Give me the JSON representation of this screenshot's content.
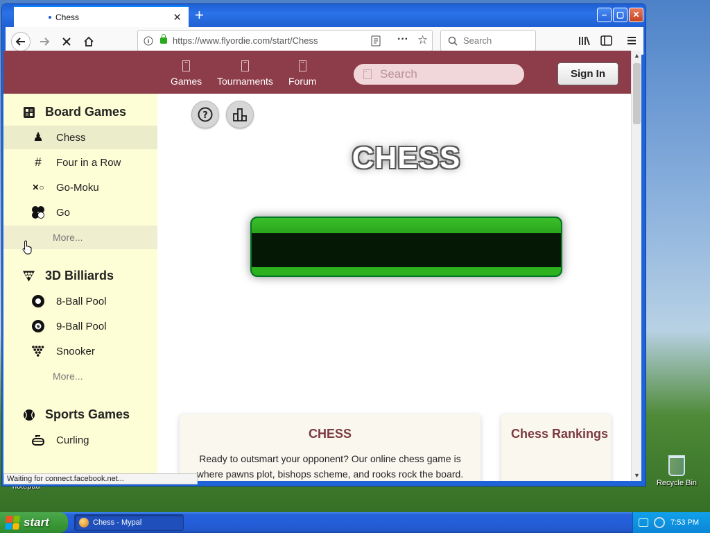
{
  "desktop": {
    "recycle_bin_label": "Recycle Bin",
    "partial_icon_label": "notepad"
  },
  "taskbar": {
    "start_label": "start",
    "task_item_label": "Chess - Mypal",
    "clock": "7:53 PM"
  },
  "browser": {
    "tab_title": "Chess",
    "url": "https://www.flyordie.com/start/Chess",
    "search_placeholder": "Search",
    "status_text": "Waiting for connect.facebook.net..."
  },
  "site": {
    "nav": [
      {
        "label": "Games"
      },
      {
        "label": "Tournaments"
      },
      {
        "label": "Forum"
      }
    ],
    "search_placeholder": "Search",
    "sign_in_label": "Sign In"
  },
  "sidebar": {
    "board_games": {
      "title": "Board Games",
      "items": [
        {
          "label": "Chess"
        },
        {
          "label": "Four in a Row"
        },
        {
          "label": "Go-Moku"
        },
        {
          "label": "Go"
        }
      ],
      "more": "More..."
    },
    "billiards": {
      "title": "3D Billiards",
      "items": [
        {
          "label": "8-Ball Pool"
        },
        {
          "label": "9-Ball Pool"
        },
        {
          "label": "Snooker"
        }
      ],
      "more": "More..."
    },
    "sports": {
      "title": "Sports Games",
      "items": [
        {
          "label": "Curling"
        }
      ]
    }
  },
  "main": {
    "title": "CHESS",
    "card": {
      "heading": "CHESS",
      "body": "Ready to outsmart your opponent? Our online chess game is where pawns plot, bishops scheme, and rooks rock the board. It's a battle of wits with a sprinkle of fun – because chess should never be boring!"
    },
    "rankings_heading": "Chess Rankings"
  },
  "colors": {
    "header_bg": "#8d3c49",
    "sidebar_bg": "#fdfdd6",
    "play_green": "#2eb11f",
    "accent_text": "#7b3a40"
  }
}
